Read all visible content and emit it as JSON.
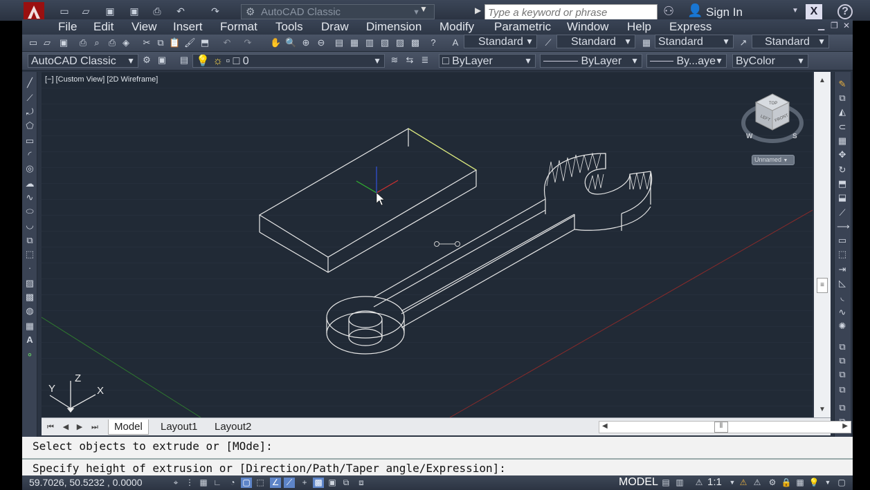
{
  "titlebar": {
    "workspace": "AutoCAD Classic",
    "search_placeholder": "Type a keyword or phrase",
    "sign_in": "Sign In",
    "icons": [
      "new-icon",
      "open-icon",
      "save-icon",
      "save-as-icon",
      "print-icon",
      "undo-icon",
      "redo-icon",
      "gear-icon",
      "binoculars-icon",
      "user-icon",
      "exchange-icon",
      "help-icon"
    ]
  },
  "menubar": {
    "items": [
      "File",
      "Edit",
      "View",
      "Insert",
      "Format",
      "Tools",
      "Draw",
      "Dimension",
      "Modify",
      "Parametric",
      "Window",
      "Help",
      "Express"
    ]
  },
  "styles_toolbar": {
    "text_style": "Standard",
    "dim_style": "Standard",
    "table_style": "Standard",
    "mleader_style": "Standard"
  },
  "layers_toolbar": {
    "workspace": "AutoCAD Classic",
    "layer": "0",
    "color": "ByLayer",
    "linetype": "ByLayer",
    "lineweight": "By...aye",
    "plotstyle": "ByColor"
  },
  "viewport": {
    "label": "[−] [Custom View] [2D Wireframe]",
    "viewcube": {
      "top": "TOP",
      "front": "FRONT",
      "left": "LEFT",
      "compass_w": "W",
      "compass_s": "S",
      "ucs": "Unnamed"
    },
    "ucs_axes": {
      "x": "X",
      "y": "Y",
      "z": "Z"
    }
  },
  "tabs": {
    "items": [
      {
        "label": "Model",
        "active": true
      },
      {
        "label": "Layout1",
        "active": false
      },
      {
        "label": "Layout2",
        "active": false
      }
    ]
  },
  "command": {
    "history": "Select objects to extrude or [MOde]:",
    "prompt": "Specify height of extrusion or [Direction/Path/Taper angle/Expression]:"
  },
  "statusbar": {
    "coordinates": "59.7026, 50.5232 , 0.0000",
    "space": "MODEL",
    "annotation_scale": "1:1"
  },
  "colors": {
    "viewport_bg": "#212a36",
    "wire": "#e8e8e8",
    "ucs_x": "#d03030",
    "ucs_y": "#30b030",
    "ucs_z": "#3050d0"
  }
}
